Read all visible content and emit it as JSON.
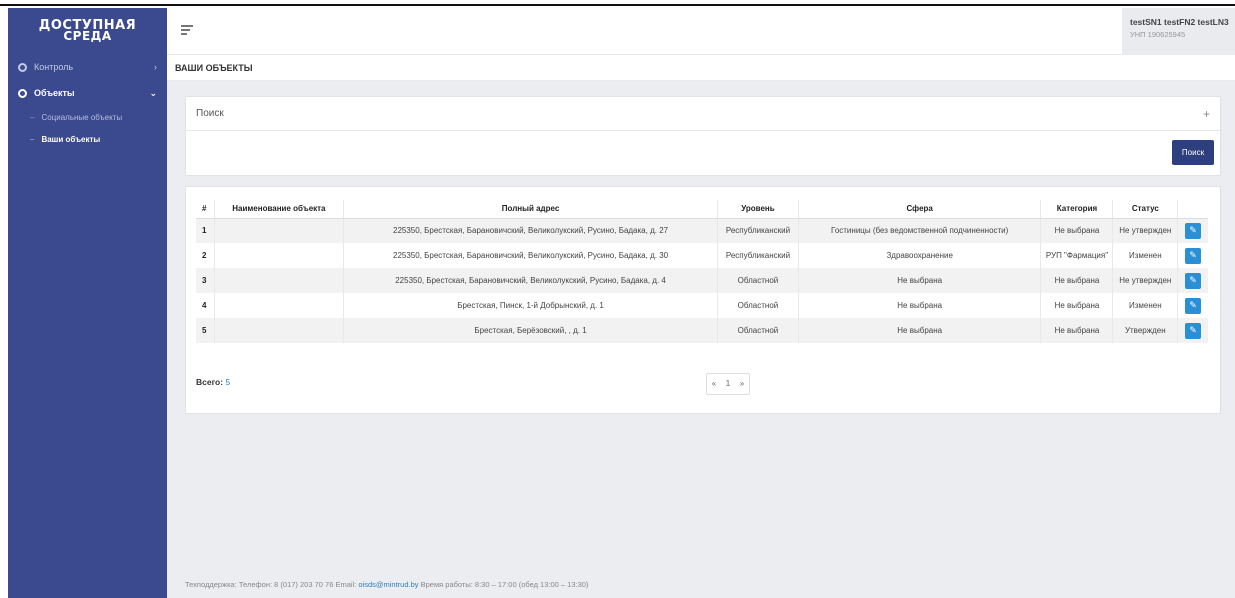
{
  "sidebar": {
    "logo_line1": "ДОСТУПНАЯ",
    "logo_line2": "СРЕДА",
    "items": [
      {
        "label": "Контроль",
        "chevron": "›"
      },
      {
        "label": "Объекты",
        "chevron": "⌄"
      }
    ],
    "subitems": [
      {
        "label": "Социальные объекты"
      },
      {
        "label": "Ваши объекты"
      }
    ]
  },
  "header": {
    "user_name": "testSN1 testFN2 testLN3",
    "user_unp": "УНП 190625945"
  },
  "breadcrumb": "ВАШИ ОБЪЕКТЫ",
  "search": {
    "title": "Поиск",
    "toggle": "+",
    "button_label": "Поиск"
  },
  "table": {
    "columns": [
      "#",
      "Наименование объекта",
      "Полный адрес",
      "Уровень",
      "Сфера",
      "Категория",
      "Статус",
      ""
    ],
    "rows": [
      {
        "num": "1",
        "name": "",
        "address": "225350, Брестская, Барановичский, Великолукский, Русино, Бадака, д. 27",
        "level": "Республиканский",
        "sphere": "Гостиницы (без ведомственной подчиненности)",
        "category": "Не выбрана",
        "status": "Не утвержден"
      },
      {
        "num": "2",
        "name": "",
        "address": "225350, Брестская, Барановичский, Великолукский, Русино, Бадака, д. 30",
        "level": "Республиканский",
        "sphere": "Здравоохранение",
        "category": "РУП \"Фармация\"",
        "status": "Изменен"
      },
      {
        "num": "3",
        "name": "",
        "address": "225350, Брестская, Барановичский, Великолукский, Русино, Бадака, д. 4",
        "level": "Областной",
        "sphere": "Не выбрана",
        "category": "Не выбрана",
        "status": "Не утвержден"
      },
      {
        "num": "4",
        "name": "",
        "address": "Брестская, Пинск, 1-й Добрынский, д. 1",
        "level": "Областной",
        "sphere": "Не выбрана",
        "category": "Не выбрана",
        "status": "Изменен"
      },
      {
        "num": "5",
        "name": "",
        "address": "Брестская, Берёзовский, , д. 1",
        "level": "Областной",
        "sphere": "Не выбрана",
        "category": "Не выбрана",
        "status": "Утвержден"
      }
    ],
    "edit_icon": "pencil-icon",
    "total_label": "Всего:",
    "total_count": "5"
  },
  "pagination": {
    "prev": "«",
    "page": "1",
    "next": "»"
  },
  "footer": {
    "text": "Техподдержка: Телефон: 8 (017) 203 70 76 Email:",
    "email": "oisds@mintrud.by",
    "hours": "Время работы: 8:30 – 17:00 (обед 13:00 – 13:30)"
  },
  "colors": {
    "sidebar": "#3b4a8f",
    "primary_button": "#2d3f7e",
    "edit_button": "#2b8fd6"
  }
}
